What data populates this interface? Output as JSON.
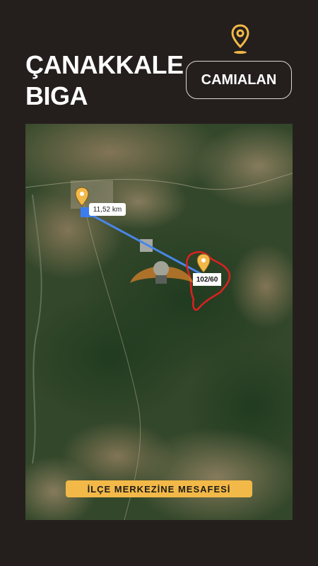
{
  "header": {
    "title_line1": "ÇANAKKALE",
    "title_line2": "BIGA",
    "village_label": "CAMIALAN"
  },
  "map": {
    "distance_label": "11,52 km",
    "parcel_label": "102/60",
    "caption": "İLÇE MERKEZİNE MESAFESİ"
  },
  "colors": {
    "background": "#241f1d",
    "pin": "#f2b948",
    "route": "#4a86e8",
    "parcel_outline": "#e02020",
    "caption_bg": "#f2b948"
  },
  "icons": {
    "header_pin": "location-pin-icon",
    "town_pin": "location-pin-icon",
    "parcel_pin": "location-pin-icon"
  }
}
